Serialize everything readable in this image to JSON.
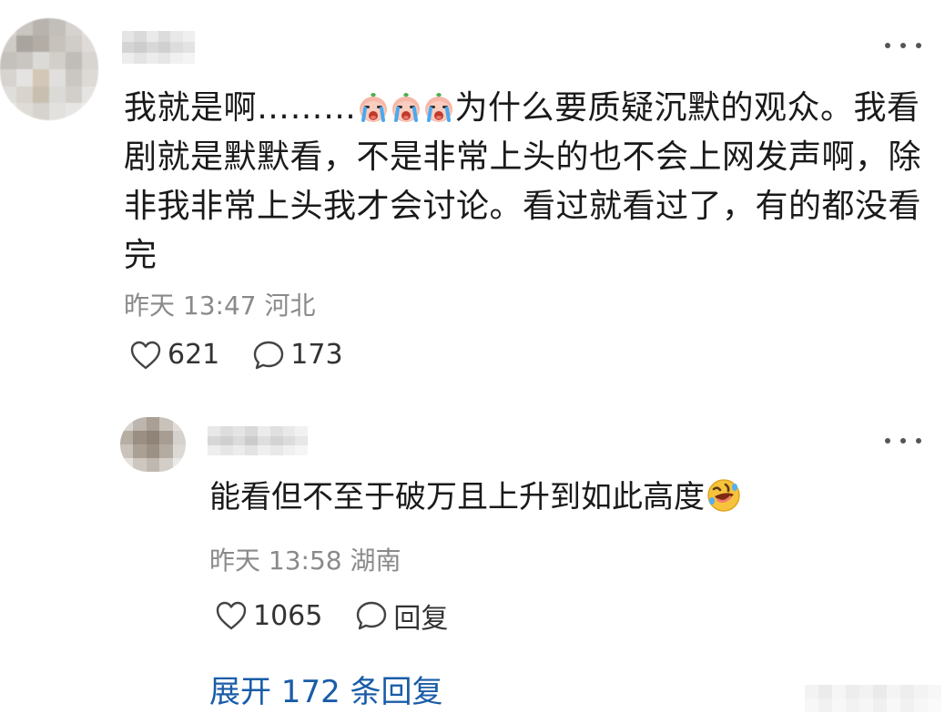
{
  "comment": {
    "text_part1": "我就是啊………",
    "text_part2": "为什么要质疑沉默的观众。我看剧就是默默看，不是非常上头的也不会上网发声啊，除非我非常上头我才会讨论。看过就看过了，有的都没看完",
    "emoji": "crying-face-emoji",
    "time": "昨天 13:47",
    "location": "河北",
    "likes": "621",
    "comments": "173",
    "more_label": "···"
  },
  "reply": {
    "text": "能看但不至于破万且上升到如此高度",
    "emoji": "rolling-laughing-emoji",
    "time": "昨天 13:58",
    "location": "湖南",
    "likes": "1065",
    "reply_label": "回复"
  },
  "expand": {
    "label": "展开 172 条回复"
  },
  "colors": {
    "link": "#1a5ca8",
    "meta": "#8a8a8a",
    "text": "#1a1a1a"
  }
}
